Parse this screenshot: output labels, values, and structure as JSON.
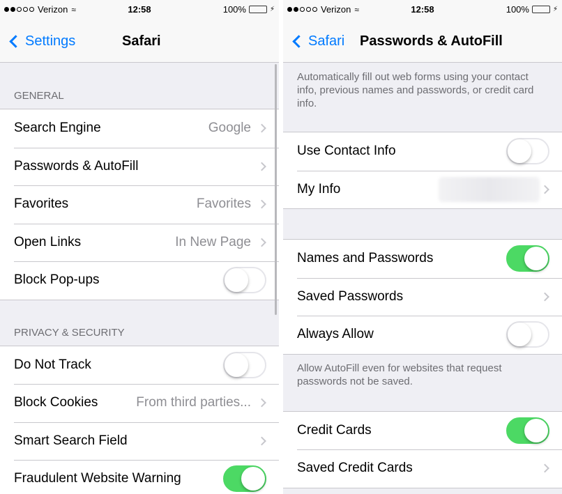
{
  "status": {
    "carrier": "Verizon",
    "signal_bars_filled": 2,
    "signal_bars_total": 5,
    "time": "12:58",
    "battery": "100%",
    "battery_color": "#4cd964"
  },
  "left": {
    "back_label": "Settings",
    "title": "Safari",
    "general_header": "GENERAL",
    "general_rows": [
      {
        "label": "Search Engine",
        "detail": "Google"
      },
      {
        "label": "Passwords & AutoFill",
        "detail": ""
      },
      {
        "label": "Favorites",
        "detail": "Favorites"
      },
      {
        "label": "Open Links",
        "detail": "In New Page"
      },
      {
        "label": "Block Pop-ups",
        "toggle": false
      }
    ],
    "privacy_header": "PRIVACY & SECURITY",
    "privacy_rows": [
      {
        "label": "Do Not Track",
        "toggle": false
      },
      {
        "label": "Block Cookies",
        "detail": "From third parties..."
      },
      {
        "label": "Smart Search Field",
        "detail": ""
      },
      {
        "label": "Fraudulent Website Warning",
        "toggle": true
      }
    ]
  },
  "right": {
    "back_label": "Safari",
    "title": "Passwords & AutoFill",
    "intro_note": "Automatically fill out web forms using your contact info, previous names and passwords, or credit card info.",
    "contact_rows": [
      {
        "label": "Use Contact Info",
        "toggle": false
      },
      {
        "label": "My Info",
        "detail": ""
      }
    ],
    "password_rows": [
      {
        "label": "Names and Passwords",
        "toggle": true
      },
      {
        "label": "Saved Passwords",
        "detail": ""
      },
      {
        "label": "Always Allow",
        "toggle": false
      }
    ],
    "always_allow_note": "Allow AutoFill even for websites that request passwords not be saved.",
    "card_rows": [
      {
        "label": "Credit Cards",
        "toggle": true
      },
      {
        "label": "Saved Credit Cards",
        "detail": ""
      }
    ]
  },
  "colors": {
    "ios_blue": "#007aff",
    "toggle_on": "#4cd964",
    "background": "#efeff4"
  }
}
